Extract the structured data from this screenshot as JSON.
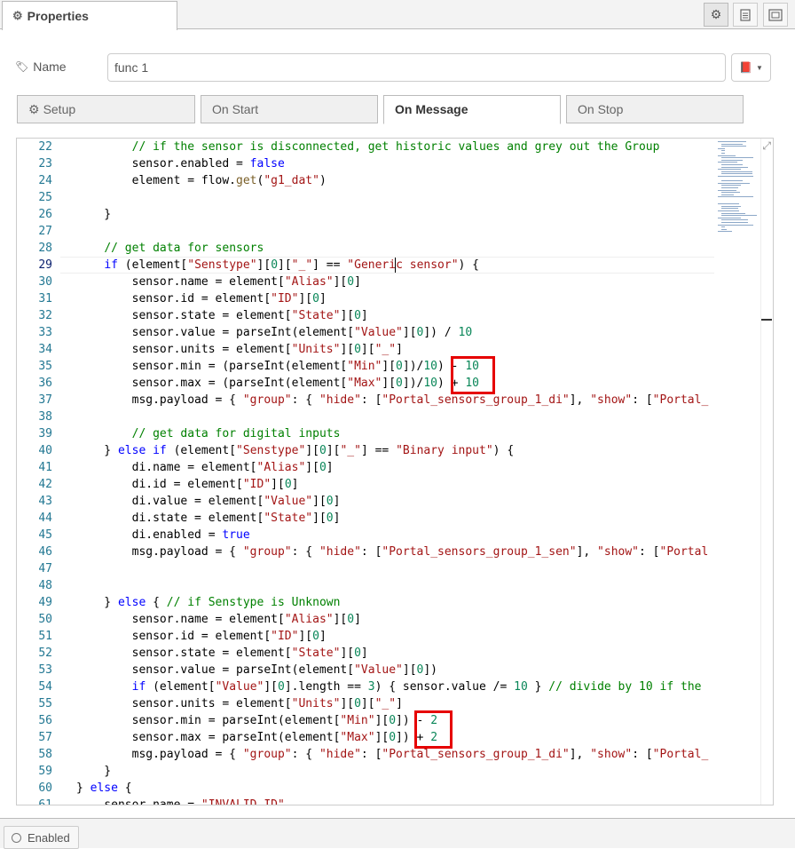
{
  "header": {
    "tab_label": "Properties",
    "tab_icon": "gear-icon",
    "buttons": [
      "settings-icon",
      "description-icon",
      "appearance-icon"
    ]
  },
  "name_field": {
    "label": "Name",
    "value": "func 1"
  },
  "tabs": [
    {
      "label": "Setup",
      "icon": "gear-icon"
    },
    {
      "label": "On Start"
    },
    {
      "label": "On Message",
      "active": true
    },
    {
      "label": "On Stop"
    }
  ],
  "editor": {
    "current_line": 29,
    "lines": [
      {
        "n": "22",
        "t": [
          [
            "",
            "        "
          ],
          [
            "c-cmt",
            "// if the sensor is disconnected, get historic values and grey out the Group"
          ]
        ]
      },
      {
        "n": "23",
        "t": [
          [
            "",
            "        sensor.enabled = "
          ],
          [
            "c-kw",
            "false"
          ]
        ]
      },
      {
        "n": "24",
        "t": [
          [
            "",
            "        element = flow."
          ],
          [
            "c-fn",
            "get"
          ],
          [
            "",
            "("
          ],
          [
            "c-str",
            "\"g1_dat\""
          ],
          [
            "",
            ")"
          ]
        ]
      },
      {
        "n": "25",
        "t": [
          [
            "",
            ""
          ]
        ]
      },
      {
        "n": "26",
        "t": [
          [
            "",
            "    }"
          ]
        ]
      },
      {
        "n": "27",
        "t": [
          [
            "",
            ""
          ]
        ]
      },
      {
        "n": "28",
        "t": [
          [
            "",
            "    "
          ],
          [
            "c-cmt",
            "// get data for sensors"
          ]
        ]
      },
      {
        "n": "29",
        "t": [
          [
            "",
            "    "
          ],
          [
            "c-kw",
            "if"
          ],
          [
            "",
            " (element["
          ],
          [
            "c-str",
            "\"Senstype\""
          ],
          [
            "",
            "]["
          ],
          [
            "c-num",
            "0"
          ],
          [
            "",
            "]["
          ],
          [
            "c-str",
            "\"_\""
          ],
          [
            "",
            "] == "
          ],
          [
            "c-str",
            "\"Generic sensor\""
          ],
          [
            "",
            ") {"
          ]
        ]
      },
      {
        "n": "30",
        "t": [
          [
            "",
            "        sensor.name = element["
          ],
          [
            "c-str",
            "\"Alias\""
          ],
          [
            "",
            "]["
          ],
          [
            "c-num",
            "0"
          ],
          [
            "",
            "]"
          ]
        ]
      },
      {
        "n": "31",
        "t": [
          [
            "",
            "        sensor.id = element["
          ],
          [
            "c-str",
            "\"ID\""
          ],
          [
            "",
            "]["
          ],
          [
            "c-num",
            "0"
          ],
          [
            "",
            "]"
          ]
        ]
      },
      {
        "n": "32",
        "t": [
          [
            "",
            "        sensor.state = element["
          ],
          [
            "c-str",
            "\"State\""
          ],
          [
            "",
            "]["
          ],
          [
            "c-num",
            "0"
          ],
          [
            "",
            "]"
          ]
        ]
      },
      {
        "n": "33",
        "t": [
          [
            "",
            "        sensor.value = parseInt(element["
          ],
          [
            "c-str",
            "\"Value\""
          ],
          [
            "",
            "]["
          ],
          [
            "c-num",
            "0"
          ],
          [
            "",
            "]) / "
          ],
          [
            "c-num",
            "10"
          ]
        ]
      },
      {
        "n": "34",
        "t": [
          [
            "",
            "        sensor.units = element["
          ],
          [
            "c-str",
            "\"Units\""
          ],
          [
            "",
            "]["
          ],
          [
            "c-num",
            "0"
          ],
          [
            "",
            "]["
          ],
          [
            "c-str",
            "\"_\""
          ],
          [
            "",
            "]"
          ]
        ]
      },
      {
        "n": "35",
        "t": [
          [
            "",
            "        sensor.min = (parseInt(element["
          ],
          [
            "c-str",
            "\"Min\""
          ],
          [
            "",
            "]["
          ],
          [
            "c-num",
            "0"
          ],
          [
            "",
            "])/"
          ],
          [
            "c-num",
            "10"
          ],
          [
            "",
            ") - "
          ],
          [
            "c-num",
            "10"
          ]
        ]
      },
      {
        "n": "36",
        "t": [
          [
            "",
            "        sensor.max = (parseInt(element["
          ],
          [
            "c-str",
            "\"Max\""
          ],
          [
            "",
            "]["
          ],
          [
            "c-num",
            "0"
          ],
          [
            "",
            "])/"
          ],
          [
            "c-num",
            "10"
          ],
          [
            "",
            ") + "
          ],
          [
            "c-num",
            "10"
          ]
        ]
      },
      {
        "n": "37",
        "t": [
          [
            "",
            "        msg.payload = { "
          ],
          [
            "c-str",
            "\"group\""
          ],
          [
            "",
            ": { "
          ],
          [
            "c-str",
            "\"hide\""
          ],
          [
            "",
            ": ["
          ],
          [
            "c-str",
            "\"Portal_sensors_group_1_di\""
          ],
          [
            "",
            "], "
          ],
          [
            "c-str",
            "\"show\""
          ],
          [
            "",
            ": ["
          ],
          [
            "c-str",
            "\"Portal_"
          ]
        ]
      },
      {
        "n": "38",
        "t": [
          [
            "",
            ""
          ]
        ]
      },
      {
        "n": "39",
        "t": [
          [
            "",
            "        "
          ],
          [
            "c-cmt",
            "// get data for digital inputs"
          ]
        ]
      },
      {
        "n": "40",
        "t": [
          [
            "",
            "    } "
          ],
          [
            "c-kw",
            "else if"
          ],
          [
            "",
            " (element["
          ],
          [
            "c-str",
            "\"Senstype\""
          ],
          [
            "",
            "]["
          ],
          [
            "c-num",
            "0"
          ],
          [
            "",
            "]["
          ],
          [
            "c-str",
            "\"_\""
          ],
          [
            "",
            "] == "
          ],
          [
            "c-str",
            "\"Binary input\""
          ],
          [
            "",
            ") {"
          ]
        ]
      },
      {
        "n": "41",
        "t": [
          [
            "",
            "        di.name = element["
          ],
          [
            "c-str",
            "\"Alias\""
          ],
          [
            "",
            "]["
          ],
          [
            "c-num",
            "0"
          ],
          [
            "",
            "]"
          ]
        ]
      },
      {
        "n": "42",
        "t": [
          [
            "",
            "        di.id = element["
          ],
          [
            "c-str",
            "\"ID\""
          ],
          [
            "",
            "]["
          ],
          [
            "c-num",
            "0"
          ],
          [
            "",
            "]"
          ]
        ]
      },
      {
        "n": "43",
        "t": [
          [
            "",
            "        di.value = element["
          ],
          [
            "c-str",
            "\"Value\""
          ],
          [
            "",
            "]["
          ],
          [
            "c-num",
            "0"
          ],
          [
            "",
            "]"
          ]
        ]
      },
      {
        "n": "44",
        "t": [
          [
            "",
            "        di.state = element["
          ],
          [
            "c-str",
            "\"State\""
          ],
          [
            "",
            "]["
          ],
          [
            "c-num",
            "0"
          ],
          [
            "",
            "]"
          ]
        ]
      },
      {
        "n": "45",
        "t": [
          [
            "",
            "        di.enabled = "
          ],
          [
            "c-kw",
            "true"
          ]
        ]
      },
      {
        "n": "46",
        "t": [
          [
            "",
            "        msg.payload = { "
          ],
          [
            "c-str",
            "\"group\""
          ],
          [
            "",
            ": { "
          ],
          [
            "c-str",
            "\"hide\""
          ],
          [
            "",
            ": ["
          ],
          [
            "c-str",
            "\"Portal_sensors_group_1_sen\""
          ],
          [
            "",
            "], "
          ],
          [
            "c-str",
            "\"show\""
          ],
          [
            "",
            ": ["
          ],
          [
            "c-str",
            "\"Portal"
          ]
        ]
      },
      {
        "n": "47",
        "t": [
          [
            "",
            ""
          ]
        ]
      },
      {
        "n": "48",
        "t": [
          [
            "",
            ""
          ]
        ]
      },
      {
        "n": "49",
        "t": [
          [
            "",
            "    } "
          ],
          [
            "c-kw",
            "else"
          ],
          [
            "",
            " { "
          ],
          [
            "c-cmt",
            "// if Senstype is Unknown"
          ]
        ]
      },
      {
        "n": "50",
        "t": [
          [
            "",
            "        sensor.name = element["
          ],
          [
            "c-str",
            "\"Alias\""
          ],
          [
            "",
            "]["
          ],
          [
            "c-num",
            "0"
          ],
          [
            "",
            "]"
          ]
        ]
      },
      {
        "n": "51",
        "t": [
          [
            "",
            "        sensor.id = element["
          ],
          [
            "c-str",
            "\"ID\""
          ],
          [
            "",
            "]["
          ],
          [
            "c-num",
            "0"
          ],
          [
            "",
            "]"
          ]
        ]
      },
      {
        "n": "52",
        "t": [
          [
            "",
            "        sensor.state = element["
          ],
          [
            "c-str",
            "\"State\""
          ],
          [
            "",
            "]["
          ],
          [
            "c-num",
            "0"
          ],
          [
            "",
            "]"
          ]
        ]
      },
      {
        "n": "53",
        "t": [
          [
            "",
            "        sensor.value = parseInt(element["
          ],
          [
            "c-str",
            "\"Value\""
          ],
          [
            "",
            "]["
          ],
          [
            "c-num",
            "0"
          ],
          [
            "",
            "])"
          ]
        ]
      },
      {
        "n": "54",
        "t": [
          [
            "",
            "        "
          ],
          [
            "c-kw",
            "if"
          ],
          [
            "",
            " (element["
          ],
          [
            "c-str",
            "\"Value\""
          ],
          [
            "",
            "]["
          ],
          [
            "c-num",
            "0"
          ],
          [
            "",
            "].length == "
          ],
          [
            "c-num",
            "3"
          ],
          [
            "",
            ") { sensor.value /= "
          ],
          [
            "c-num",
            "10"
          ],
          [
            "",
            " } "
          ],
          [
            "c-cmt",
            "// divide by 10 if the"
          ]
        ]
      },
      {
        "n": "55",
        "t": [
          [
            "",
            "        sensor.units = element["
          ],
          [
            "c-str",
            "\"Units\""
          ],
          [
            "",
            "]["
          ],
          [
            "c-num",
            "0"
          ],
          [
            "",
            "]["
          ],
          [
            "c-str",
            "\"_\""
          ],
          [
            "",
            "]"
          ]
        ]
      },
      {
        "n": "56",
        "t": [
          [
            "",
            "        sensor.min = parseInt(element["
          ],
          [
            "c-str",
            "\"Min\""
          ],
          [
            "",
            "]["
          ],
          [
            "c-num",
            "0"
          ],
          [
            "",
            "]) - "
          ],
          [
            "c-num",
            "2"
          ]
        ]
      },
      {
        "n": "57",
        "t": [
          [
            "",
            "        sensor.max = parseInt(element["
          ],
          [
            "c-str",
            "\"Max\""
          ],
          [
            "",
            "]["
          ],
          [
            "c-num",
            "0"
          ],
          [
            "",
            "]) + "
          ],
          [
            "c-num",
            "2"
          ]
        ]
      },
      {
        "n": "58",
        "t": [
          [
            "",
            "        msg.payload = { "
          ],
          [
            "c-str",
            "\"group\""
          ],
          [
            "",
            ": { "
          ],
          [
            "c-str",
            "\"hide\""
          ],
          [
            "",
            ": ["
          ],
          [
            "c-str",
            "\"Portal_sensors_group_1_di\""
          ],
          [
            "",
            "], "
          ],
          [
            "c-str",
            "\"show\""
          ],
          [
            "",
            ": ["
          ],
          [
            "c-str",
            "\"Portal_"
          ]
        ]
      },
      {
        "n": "59",
        "t": [
          [
            "",
            "    }"
          ]
        ]
      },
      {
        "n": "60",
        "t": [
          [
            "",
            "} "
          ],
          [
            "c-kw",
            "else"
          ],
          [
            "",
            " {"
          ]
        ]
      },
      {
        "n": "61",
        "t": [
          [
            "",
            "    sensor.name = "
          ],
          [
            "c-str",
            "\"INVALID_ID\""
          ]
        ]
      }
    ]
  },
  "footer": {
    "enabled_label": "Enabled"
  }
}
